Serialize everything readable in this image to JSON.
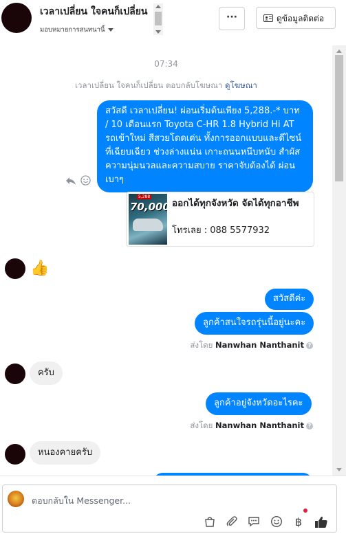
{
  "header": {
    "name": "เวลาเปลี่ยน ใจคนก็เปลี่ยน",
    "subtitle": "มอบหมายการสนทนานี้",
    "more_label": "···",
    "contact_label": "ดูข้อมูลติดต่อ"
  },
  "chat": {
    "timestamp": "07:34",
    "reply_note": "เวลาเปลี่ยน ใจคนก็เปลี่ยน ตอบกลับโฆษณา",
    "reply_link": "ดูโฆษณา",
    "ad_message": "สวัสดี เวลาเปลี่ยน! ผ่อนเริ่มต้นเพียง 5,288.-* บาท / 10 เดือนแรก Toyota C-HR 1.8 Hybrid Hi AT รถเข้าใหม่ สีสวยโดดเด่น ทั้งการออกแบบและดีไซน์ที่เฉียบเฉียว ช่วงล่างแน่น เกาะถนนหนึบหนับ สำผัสความนุ่มนวลและความสบาย ราคาจับต้องได้ ผ่อนเบาๆ",
    "ad_card": {
      "title": "ออกได้ทุกจังหวัด จัดได้ทุกอาชีพ",
      "phone": "โทรเลย : 088 5577932",
      "image_price": "70,000.-",
      "image_tag": "5,288"
    },
    "messages": {
      "thumbs": "👍",
      "out1": "สวัสดีค่ะ",
      "out2": "ลูกค้าสนใจรถรุ่นนี้อยู่นะคะ",
      "sent_by_prefix": "ส่งโดย",
      "sender": "Nanwhan Nanthanit",
      "in1": "ครับ",
      "out3": "ลูกค้าอยู่จังหวัดอะไรคะ",
      "in2": "หนองคายครับ"
    }
  },
  "composer": {
    "placeholder": "ตอบกลับใน Messenger...",
    "tools": [
      "bag-icon",
      "paperclip-icon",
      "quick-reply-icon",
      "emoji-icon",
      "baht-icon",
      "like-icon"
    ],
    "baht_symbol": "฿"
  },
  "colors": {
    "accent": "#0084ff",
    "incoming": "#f1f0f0",
    "link": "#385898"
  }
}
